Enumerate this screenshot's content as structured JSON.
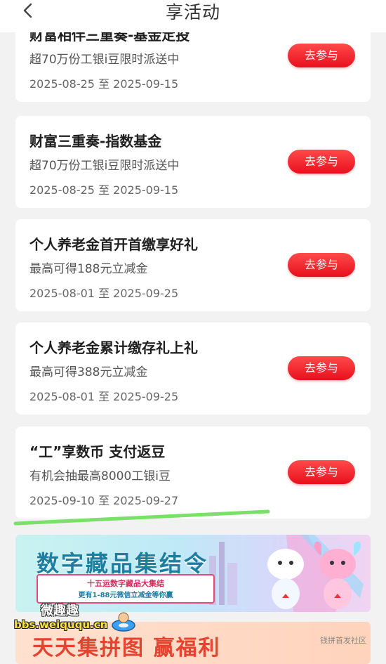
{
  "header": {
    "title": "享活动",
    "back_icon": "chevron-left-icon"
  },
  "activities": [
    {
      "title": "财富相伴三重奏-基金定投",
      "desc": "超70万份工银i豆限时派送中",
      "date": "2025-08-25 至 2025-09-15",
      "button": "去参与"
    },
    {
      "title": "财富三重奏-指数基金",
      "desc": "超70万份工银i豆限时派送中",
      "date": "2025-08-25 至 2025-09-15",
      "button": "去参与"
    },
    {
      "title": "个人养老金首开首缴享好礼",
      "desc": "最高可得188元立减金",
      "date": "2025-08-01 至 2025-09-25",
      "button": "去参与"
    },
    {
      "title": "个人养老金累计缴存礼上礼",
      "desc": "最高可得388元立减金",
      "date": "2025-08-01 至 2025-09-25",
      "button": "去参与"
    },
    {
      "title": "“工”享数币 支付返豆",
      "desc": "有机会抽最高8000工银i豆",
      "date": "2025-09-10 至 2025-09-27",
      "button": "去参与"
    }
  ],
  "banner1": {
    "title": "数字藏品集结令",
    "sub1": "十五运数字藏品大集结",
    "sub2": "更有1-88元微信立减金等你赢"
  },
  "banner2": {
    "title": "天天集拼图 赢福利",
    "tag": "钱拼首发社区"
  },
  "watermark": {
    "name": "微趣趣",
    "url": "bbs.weiququ.cn"
  },
  "colors": {
    "accent": "#e8101e",
    "highlight_stroke": "#7be06a"
  }
}
